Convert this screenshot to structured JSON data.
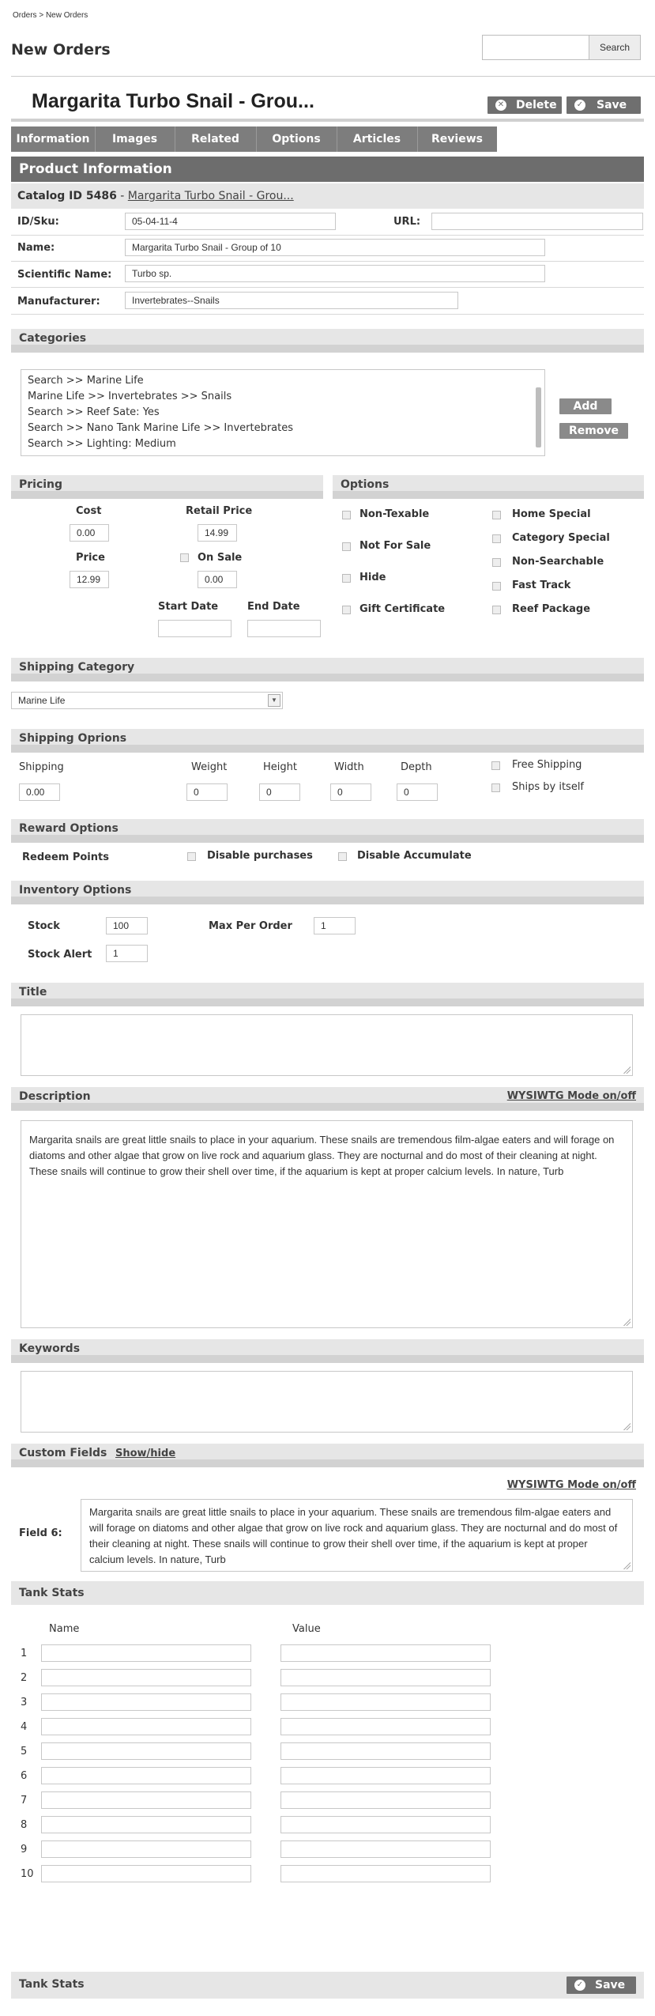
{
  "breadcrumb": "Orders > New Orders",
  "page_title": "New Orders",
  "search": {
    "value": "",
    "button": "Search"
  },
  "product": {
    "title": "Margarita Turbo Snail - Grou..."
  },
  "actions": {
    "delete": "Delete",
    "save": "Save"
  },
  "tabs": [
    "Information",
    "Images",
    "Related",
    "Options",
    "Articles",
    "Reviews"
  ],
  "product_info": {
    "header": "Product Information",
    "catalog_label": "Catalog ID 5486",
    "catalog_sep": " - ",
    "catalog_link": "Margarita Turbo Snail - Grou...",
    "id_sku_label": "ID/Sku:",
    "id_sku_value": "05-04-11-4",
    "url_label": "URL:",
    "url_value": "",
    "name_label": "Name:",
    "name_value": "Margarita Turbo Snail - Group of 10",
    "sci_label": "Scientific Name:",
    "sci_value": "Turbo sp.",
    "mfr_label": "Manufacturer:",
    "mfr_value": "Invertebrates--Snails"
  },
  "categories": {
    "header": "Categories",
    "items": [
      "Search >> Marine Life",
      "Marine Life >> Invertebrates >> Snails",
      "Search >> Reef Sate: Yes",
      "Search >> Nano Tank Marine Life >> Invertebrates",
      "Search >> Lighting: Medium"
    ],
    "add": "Add",
    "remove": "Remove"
  },
  "pricing": {
    "header": "Pricing",
    "cost_label": "Cost",
    "cost_value": "0.00",
    "retail_label": "Retail Price",
    "retail_value": "14.99",
    "price_label": "Price",
    "price_value": "12.99",
    "onsale_label": "On Sale",
    "onsale_value": "0.00",
    "start_label": "Start Date",
    "end_label": "End Date"
  },
  "options": {
    "header": "Options",
    "left": [
      "Non-Texable",
      "Not For Sale",
      "Hide",
      "Gift Certificate"
    ],
    "right": [
      "Home Special",
      "Category Special",
      "Non-Searchable",
      "Fast Track",
      "Reef Package"
    ]
  },
  "shipping_category": {
    "header": "Shipping Category",
    "selected": "Marine Life"
  },
  "shipping_options": {
    "header": "Shipping Oprions",
    "shipping_label": "Shipping",
    "shipping_value": "0.00",
    "weight_label": "Weight",
    "weight_value": "0",
    "height_label": "Height",
    "height_value": "0",
    "width_label": "Width",
    "width_value": "0",
    "depth_label": "Depth",
    "depth_value": "0",
    "free_shipping": "Free Shipping",
    "ships_itself": "Ships by itself"
  },
  "reward": {
    "header": "Reward Options",
    "redeem": "Redeem Points",
    "disable_purchases": "Disable purchases",
    "disable_accumulate": "Disable Accumulate"
  },
  "inventory": {
    "header": "Inventory Options",
    "stock_label": "Stock",
    "stock_value": "100",
    "max_label": "Max Per Order",
    "max_value": "1",
    "alert_label": "Stock Alert",
    "alert_value": "1"
  },
  "title_section": {
    "header": "Title"
  },
  "description": {
    "header": "Description",
    "wysiwyg": "WYSIWTG Mode on/off",
    "text": "Margarita snails are great little snails to place in your aquarium. These snails are tremendous film-algae eaters and will forage on diatoms and other algae that grow on live rock and aquarium glass. They are nocturnal and do most of their cleaning at night. These snails will continue to grow their shell over time, if the aquarium is kept at proper calcium levels. In nature, Turb"
  },
  "keywords": {
    "header": "Keywords"
  },
  "custom_fields": {
    "header": "Custom Fields",
    "toggle": "Show/hide",
    "wysiwyg": "WYSIWTG Mode on/off",
    "field_label": "Field 6:",
    "field_text": "Margarita snails are great little snails to place in your aquarium. These snails are tremendous film-algae eaters and will forage on diatoms and other algae that grow on live rock and aquarium glass. They are nocturnal and do most of their cleaning at night. These snails will continue to grow their shell over time, if the aquarium is kept at proper calcium levels. In nature, Turb"
  },
  "tank_stats": {
    "header": "Tank Stats",
    "name_col": "Name",
    "value_col": "Value",
    "rows": [
      "1",
      "2",
      "3",
      "4",
      "5",
      "6",
      "7",
      "8",
      "9",
      "10"
    ]
  },
  "footer": {
    "label": "Tank Stats",
    "save": "Save"
  },
  "colors": {
    "tab_bg": "#7d7d7d",
    "header_bg": "#6d6d6d",
    "section_bg": "#e6e6e6"
  }
}
